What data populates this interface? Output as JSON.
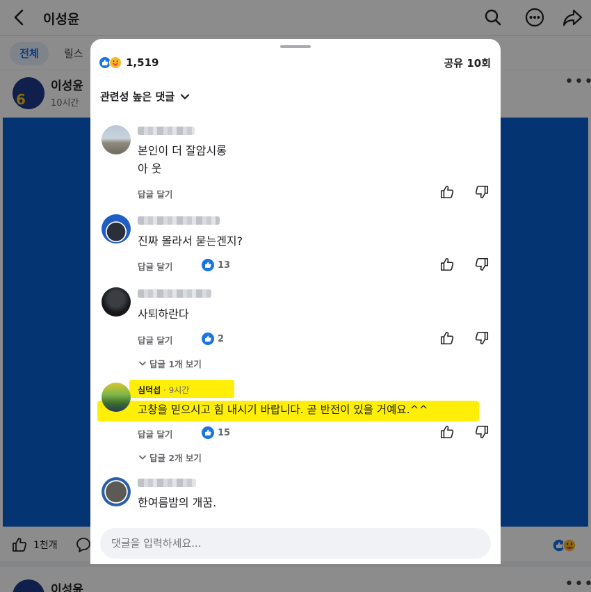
{
  "bg": {
    "title": "이성윤",
    "tabs": [
      "전체",
      "릴스"
    ],
    "post": {
      "author": "이성윤",
      "time": "10시간",
      "like_count": "1천개",
      "avatar_number": "6"
    },
    "post2": {
      "author": "이성윤"
    }
  },
  "sheet": {
    "reaction_count": "1,519",
    "share_count": "공유 10회",
    "sort_label": "관련성 높은 댓글",
    "input_placeholder": "댓글을 입력하세요...",
    "comments": [
      {
        "text": "본인이 더 잘암시롱\n아 웃",
        "reply_label": "답글 달기",
        "likes": ""
      },
      {
        "text": "진짜 몰라서 묻는겐지?",
        "reply_label": "답글 달기",
        "likes": "13"
      },
      {
        "text": "사퇴하란다",
        "reply_label": "답글 달기",
        "likes": "2",
        "more_replies": "답글 1개 보기"
      },
      {
        "name": "심덕섭",
        "time": " · 9시간",
        "text": "고창을 믿으시고 힘 내시기 바랍니다. 곧 반전이 있을 거예요.^^",
        "reply_label": "답글 달기",
        "likes": "15",
        "more_replies": "답글 2개 보기"
      },
      {
        "text": "한여름밤의 개꿈.",
        "reply_label": "",
        "likes": ""
      }
    ]
  },
  "colors": {
    "accent": "#1b74e4",
    "highlight": "#ffef08",
    "post_image": "#0a5fd0"
  },
  "icons": [
    "back-icon",
    "search-icon",
    "more-icon",
    "share-icon",
    "thumb-up-icon",
    "thumb-down-icon",
    "chevron-down-icon",
    "comment-icon"
  ]
}
